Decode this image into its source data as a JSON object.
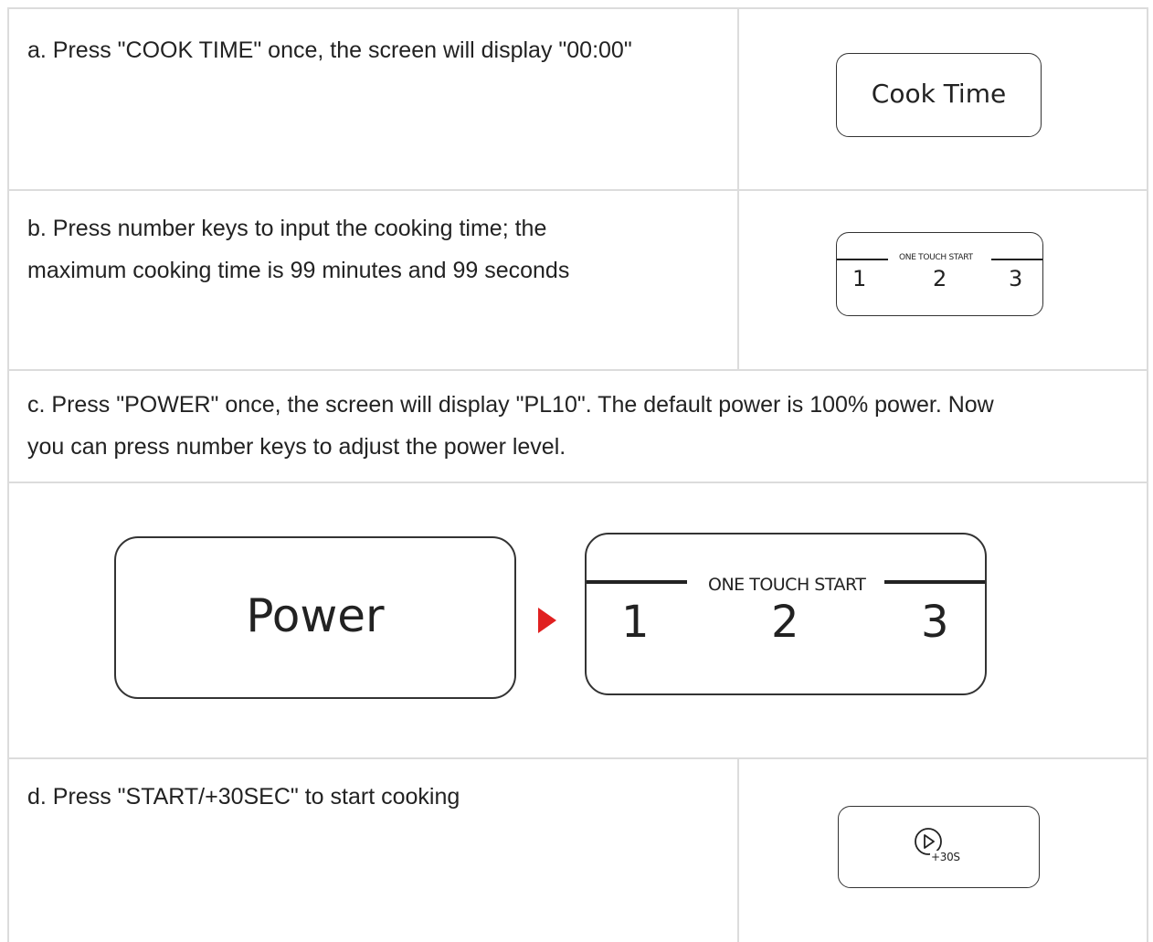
{
  "steps": {
    "a": {
      "text": "a. Press \"COOK TIME\" once, the screen will display \"00:00\"",
      "key_label": "Cook Time"
    },
    "b": {
      "text_line1": "b. Press number keys to input the cooking time; the",
      "text_line2": "maximum cooking time is 99 minutes and 99 seconds",
      "key_caption": "ONE TOUCH START",
      "keys": [
        "1",
        "2",
        "3"
      ]
    },
    "c": {
      "text_line1": "c. Press \"POWER\" once, the screen will display \"PL10\". The default power is 100% power. Now",
      "text_line2": "you can press number keys to adjust the power level.",
      "power_label": "Power",
      "key_caption": "ONE TOUCH START",
      "keys": [
        "1",
        "2",
        "3"
      ],
      "arrow_color": "#e02020"
    },
    "d": {
      "text": "d. Press \"START/+30SEC\" to start cooking",
      "icon": "play-icon",
      "icon_caption": "+30S"
    }
  }
}
